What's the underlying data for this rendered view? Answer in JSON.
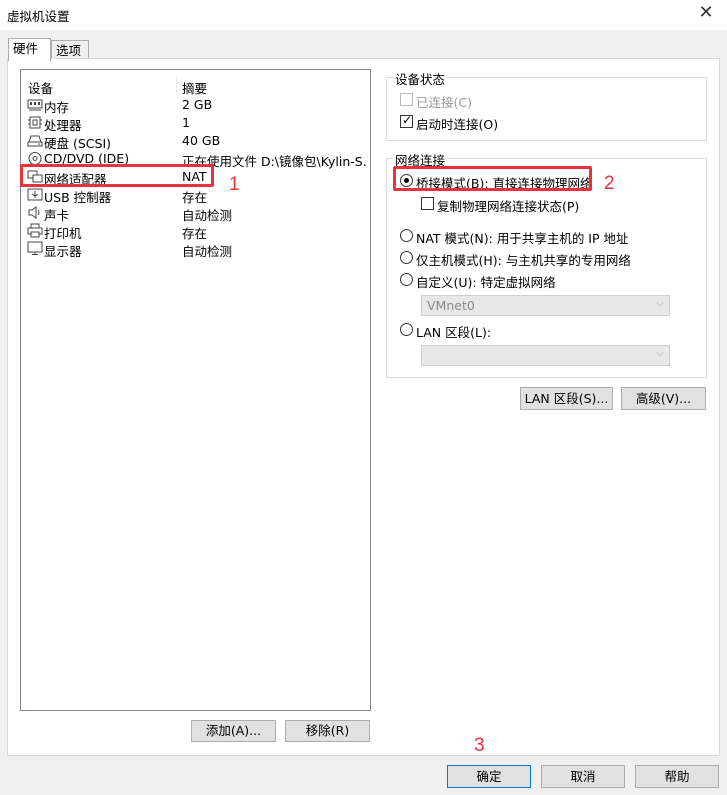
{
  "window": {
    "title": "虚拟机设置",
    "close_glyph": "✕"
  },
  "tabs": [
    {
      "label": "硬件",
      "active": true
    },
    {
      "label": "选项",
      "active": false
    }
  ],
  "device_list": {
    "columns": [
      "设备",
      "摘要"
    ],
    "rows": [
      {
        "name": "内存",
        "summary": "2 GB",
        "icon": "memory-icon"
      },
      {
        "name": "处理器",
        "summary": "1",
        "icon": "processor-icon"
      },
      {
        "name": "硬盘 (SCSI)",
        "summary": "40 GB",
        "icon": "hard-disk-icon"
      },
      {
        "name": "CD/DVD (IDE)",
        "summary": "正在使用文件 D:\\镜像包\\Kylin-S...",
        "icon": "cd-dvd-icon"
      },
      {
        "name": "网络适配器",
        "summary": "NAT",
        "icon": "network-adapter-icon"
      },
      {
        "name": "USB 控制器",
        "summary": "存在",
        "icon": "usb-icon"
      },
      {
        "name": "声卡",
        "summary": "自动检测",
        "icon": "speaker-icon"
      },
      {
        "name": "打印机",
        "summary": "存在",
        "icon": "printer-icon"
      },
      {
        "name": "显示器",
        "summary": "自动检测",
        "icon": "display-icon"
      }
    ]
  },
  "device_buttons": {
    "add": "添加(A)...",
    "remove": "移除(R)"
  },
  "device_status": {
    "title": "设备状态",
    "connected": {
      "label": "已连接(C)",
      "checked": false,
      "disabled": true
    },
    "connect_on_power_on": {
      "label": "启动时连接(O)",
      "checked": true
    }
  },
  "network_connection": {
    "title": "网络连接",
    "bridged": {
      "label": "桥接模式(B): 直接连接物理网络",
      "selected": true
    },
    "replicate": {
      "label": "复制物理网络连接状态(P)",
      "checked": false
    },
    "nat": {
      "label": "NAT 模式(N): 用于共享主机的 IP 地址",
      "selected": false
    },
    "host_only": {
      "label": "仅主机模式(H): 与主机共享的专用网络",
      "selected": false
    },
    "custom": {
      "label": "自定义(U): 特定虚拟网络",
      "selected": false
    },
    "custom_value": "VMnet0",
    "lan_segment": {
      "label": "LAN 区段(L):",
      "selected": false
    },
    "lan_value": "",
    "dropdown_arrow": "⌵"
  },
  "right_buttons": {
    "lan_segments": "LAN 区段(S)...",
    "advanced": "高级(V)..."
  },
  "footer_buttons": {
    "ok": "确定",
    "cancel": "取消",
    "help": "帮助"
  },
  "annotations": {
    "one": "1",
    "two": "2",
    "three": "3"
  },
  "colors": {
    "highlight": "#e8323c",
    "accent": "#0078d7"
  }
}
